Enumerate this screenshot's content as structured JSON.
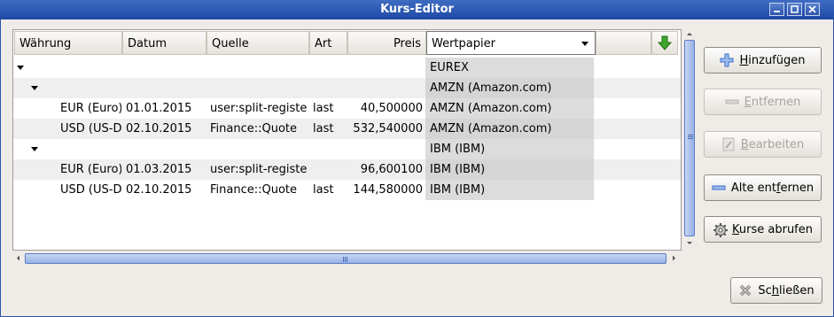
{
  "window": {
    "title": "Kurs-Editor"
  },
  "table": {
    "columns": {
      "currency": "Währung",
      "date": "Datum",
      "source": "Quelle",
      "type": "Art",
      "price": "Preis",
      "security": "Wertpapier"
    },
    "rows": [
      {
        "currency": "",
        "date": "",
        "source": "",
        "type": "",
        "price": "",
        "security": "EUREX"
      },
      {
        "currency": "",
        "date": "",
        "source": "",
        "type": "",
        "price": "",
        "security": "AMZN (Amazon.com)"
      },
      {
        "currency": "EUR (Euro)",
        "date": "01.01.2015",
        "source": "user:split-register",
        "type": "last",
        "price": "40,500000",
        "security": "AMZN (Amazon.com)"
      },
      {
        "currency": "USD (US-Dollar)",
        "date": "02.10.2015",
        "source": "Finance::Quote",
        "type": "last",
        "price": "532,540000",
        "security": "AMZN (Amazon.com)"
      },
      {
        "currency": "",
        "date": "",
        "source": "",
        "type": "",
        "price": "",
        "security": "IBM (IBM)"
      },
      {
        "currency": "EUR (Euro)",
        "date": "01.03.2015",
        "source": "user:split-register",
        "type": "",
        "price": "96,600100",
        "security": "IBM (IBM)"
      },
      {
        "currency": "USD (US-Dollar)",
        "date": "02.10.2015",
        "source": "Finance::Quote",
        "type": "last",
        "price": "144,580000",
        "security": "IBM (IBM)"
      }
    ]
  },
  "buttons": {
    "add": {
      "mnemonic": "H",
      "rest": "inzufügen"
    },
    "remove": {
      "mnemonic": "E",
      "rest": "ntfernen"
    },
    "edit": {
      "mnemonic": "B",
      "rest": "earbeiten"
    },
    "remove_old": {
      "before": "Alte ent",
      "mnemonic": "f",
      "after": "ernen"
    },
    "fetch": {
      "mnemonic": "K",
      "rest": "urse abrufen"
    },
    "close": {
      "before": "Sc",
      "mnemonic": "h",
      "after": "ließen"
    }
  },
  "colors": {
    "titlebar": "#2c55ad",
    "accent": "#3b6dd1",
    "sort_arrow": "#3fa52c"
  }
}
